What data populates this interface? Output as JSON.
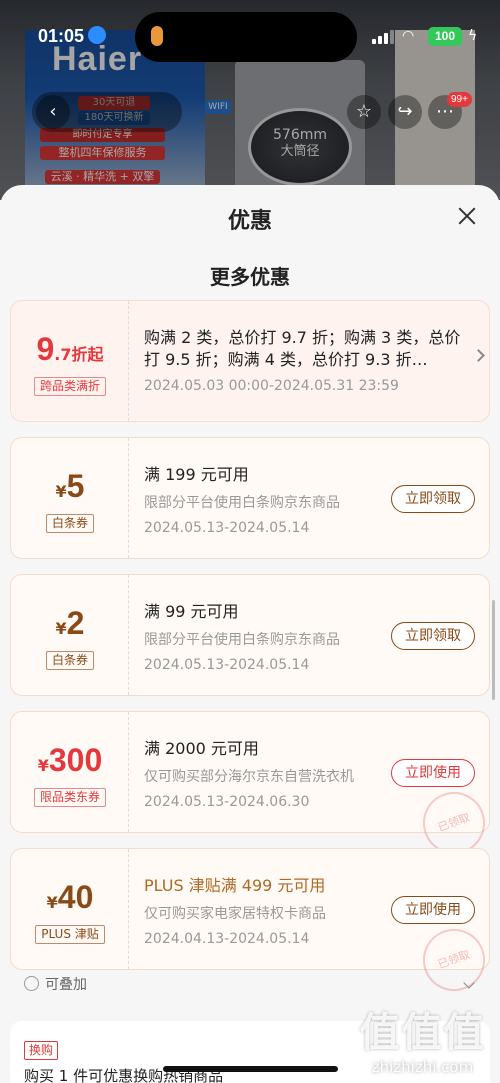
{
  "status_bar": {
    "time": "01:05",
    "battery": "100"
  },
  "background": {
    "brand": "Haier",
    "tag_return": "30天可退",
    "tag_exchange": "180天可换新",
    "tag_instant": "即时付定专享",
    "tag_warranty": "整机四年保修服务",
    "tag_series": "云溪 · 精华洗 + 双擎",
    "drum_size": "576mm",
    "drum_label": "大筒径",
    "wifi_label": "WIFI",
    "cart_badge": "99+"
  },
  "sheet": {
    "title": "优惠",
    "section_title": "更多优惠",
    "coupons": [
      {
        "amount_big": "9",
        "amount_small": ".7折起",
        "tag": "跨品类满折",
        "title": "购满 2 类，总价打 9.7 折；购满 3 类，总价打 9.5 折；购满 4 类，总价打 9.3 折…",
        "date": "2024.05.03 00:00-2024.05.31 23:59"
      },
      {
        "currency": "¥",
        "amount_big": "5",
        "tag": "白条券",
        "title": "满 199 元可用",
        "desc": "限部分平台使用白条购京东商品",
        "date": "2024.05.13-2024.05.14",
        "action": "立即领取"
      },
      {
        "currency": "¥",
        "amount_big": "2",
        "tag": "白条券",
        "title": "满 99 元可用",
        "desc": "限部分平台使用白条购京东商品",
        "date": "2024.05.13-2024.05.14",
        "action": "立即领取"
      },
      {
        "currency": "¥",
        "amount_big": "300",
        "tag": "限品类东券",
        "title": "满 2000 元可用",
        "desc": "仅可购买部分海尔京东自营洗衣机",
        "date": "2024.05.13-2024.06.30",
        "action": "立即使用",
        "stamp": "已领取"
      },
      {
        "currency": "¥",
        "amount_big": "40",
        "tag": "PLUS 津贴",
        "title": "PLUS 津贴满 499 元可用",
        "desc": "仅可购买家电家居特权卡商品",
        "date": "2024.04.13-2024.05.14",
        "action": "立即使用",
        "stamp": "已领取"
      }
    ],
    "stackable": "可叠加",
    "swap_tag": "换购",
    "swap_text": "购买 1 件可优惠换购热销商品"
  },
  "watermark": {
    "logo": "值值值",
    "url": "zhizhizhi.com"
  },
  "colors": {
    "accent_red": "#e4393c",
    "coupon_brown": "#8a4a17",
    "plus_gold": "#b06a24"
  }
}
